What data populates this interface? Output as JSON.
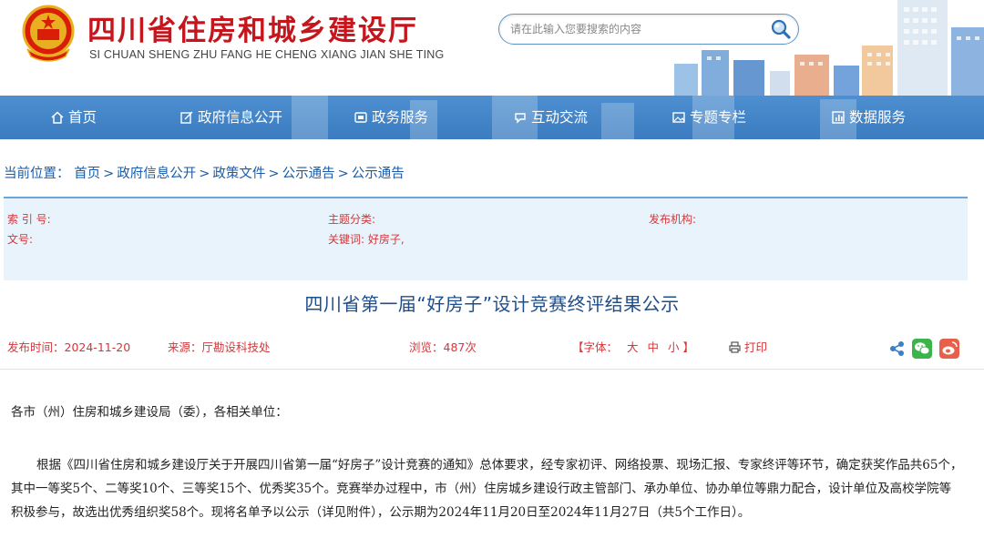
{
  "header": {
    "title": "四川省住房和城乡建设厅",
    "subtitle": "SI CHUAN SHENG ZHU FANG HE CHENG XIANG JIAN SHE TING",
    "search_placeholder": "请在此输入您要搜索的内容"
  },
  "nav": {
    "items": [
      {
        "label": "首页",
        "icon": "home-icon"
      },
      {
        "label": "政府信息公开",
        "icon": "edit-icon"
      },
      {
        "label": "政务服务",
        "icon": "service-icon"
      },
      {
        "label": "互动交流",
        "icon": "interaction-icon"
      },
      {
        "label": "专题专栏",
        "icon": "image-icon"
      },
      {
        "label": "数据服务",
        "icon": "data-icon"
      }
    ]
  },
  "breadcrumb": {
    "label": "当前位置：",
    "items": [
      "首页",
      "政府信息公开",
      "政策文件",
      "公示通告",
      "公示通告"
    ],
    "separator": ">"
  },
  "meta": {
    "index_label": "索 引 号:",
    "index_value": "",
    "topic_label": "主题分类:",
    "topic_value": "",
    "org_label": "发布机构:",
    "org_value": "",
    "doc_label": "文号:",
    "doc_value": "",
    "keyword_label": "关键词:",
    "keyword_value": "好房子,"
  },
  "article": {
    "title": "四川省第一届“好房子”设计竞赛终评结果公示",
    "publish_time": "发布时间：2024-11-20",
    "source": "来源：厅勘设科技处",
    "views": "浏览：487次",
    "font_label": "【字体：",
    "font_large": "大",
    "font_medium": "中",
    "font_small": "小",
    "font_end": "】",
    "print": "打印",
    "greeting": "各市（州）住房和城乡建设局（委），各相关单位：",
    "paragraph": "根据《四川省住房和城乡建设厅关于开展四川省第一届“好房子”设计竞赛的通知》总体要求，经专家初评、网络投票、现场汇报、专家终评等环节，确定获奖作品共65个，其中一等奖5个、二等奖10个、三等奖15个、优秀奖35个。竞赛举办过程中，市（州）住房城乡建设行政主管部门、承办单位、协办单位等鼎力配合，设计单位及高校学院等积极参与，故选出优秀组织奖58个。现将名单予以公示（详见附件），公示期为2024年11月20日至2024年11月27日（共5个工作日）。"
  },
  "share": {
    "icons": [
      "share-icon",
      "wechat-icon",
      "weibo-icon"
    ],
    "colors": {
      "wechat": "#3bb54a",
      "weibo": "#e8604c",
      "share": "#3a80c7"
    }
  },
  "colors": {
    "title_red": "#c4161c",
    "nav_blue": "#4187c9",
    "link_blue": "#1a5ca8",
    "meta_bg": "#e9f3fb",
    "meta_red": "#d4373a",
    "heading_blue": "#1f4e8c"
  }
}
